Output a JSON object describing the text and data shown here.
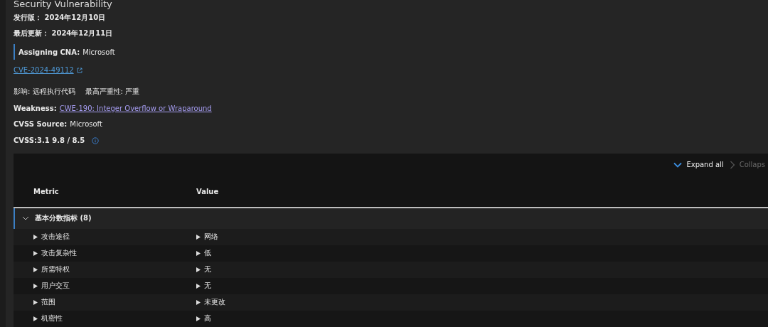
{
  "page": {
    "title": "Security Vulnerability"
  },
  "dates": [
    {
      "label": "发行版：",
      "value": "2024年12月10日"
    },
    {
      "label": "最后更新：",
      "value": "2024年12月11日"
    }
  ],
  "cna": {
    "label": "Assigning CNA:",
    "value": "Microsoft"
  },
  "cve_link": "CVE-2024-49112",
  "impact": {
    "label": "影响:",
    "value": "远程执行代码"
  },
  "severity": {
    "label": "最高严重性:",
    "value": "严重"
  },
  "weakness": {
    "label": "Weakness:",
    "link": "CWE-190: Integer Overflow or Wraparound"
  },
  "cvss_source": {
    "label": "CVSS Source:",
    "value": "Microsoft"
  },
  "cvss": "CVSS:3.1 9.8 / 8.5",
  "table": {
    "actions": [
      {
        "label": "Expand all",
        "disabled": false,
        "kind": "expand"
      },
      {
        "label": "Collaps",
        "disabled": true,
        "kind": "collapse"
      }
    ],
    "columns": [
      "Metric",
      "Value"
    ],
    "groups": [
      {
        "label": "基本分数指标 (8)",
        "expanded": true,
        "rows": [
          {
            "metric": "攻击途径",
            "value": "网络"
          },
          {
            "metric": "攻击复杂性",
            "value": "低"
          },
          {
            "metric": "所需特权",
            "value": "无"
          },
          {
            "metric": "用户交互",
            "value": "无"
          },
          {
            "metric": "范围",
            "value": "未更改"
          },
          {
            "metric": "机密性",
            "value": "高"
          }
        ]
      }
    ]
  }
}
